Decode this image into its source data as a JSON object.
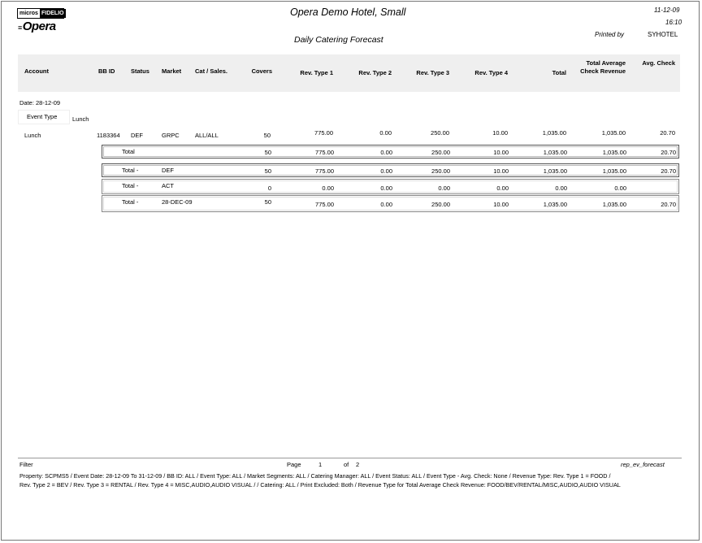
{
  "header": {
    "logo_left": "micros",
    "logo_right": "FIDELIO",
    "brand": "Opera",
    "hotel_name": "Opera Demo Hotel, Small",
    "report_title": "Daily Catering Forecast",
    "date": "11-12-09",
    "time": "16:10",
    "printed_by_label": "Printed by",
    "printed_by_value": "SYHOTEL"
  },
  "columns": {
    "account": "Account",
    "bb_id": "BB ID",
    "status": "Status",
    "market": "Market",
    "cat_sales": "Cat / Sales.",
    "covers": "Covers",
    "rev1": "Rev. Type 1",
    "rev2": "Rev. Type 2",
    "rev3": "Rev. Type 3",
    "rev4": "Rev. Type 4",
    "total": "Total",
    "tavg_line1": "Total Average",
    "tavg_line2": "Check Revenue",
    "avg_check": "Avg. Check"
  },
  "group": {
    "date_label": "Date: 28-12-09",
    "event_type_label": "Event Type",
    "event_type_value": "Lunch"
  },
  "detail_row": {
    "account": "Lunch",
    "bb_id": "1183364",
    "status": "DEF",
    "market": "GRPC",
    "cat_sales": "ALL/ALL",
    "covers": "50",
    "rev1": "775.00",
    "rev2": "0.00",
    "rev3": "250.00",
    "rev4": "10.00",
    "total": "1,035.00",
    "tavg": "1,035.00",
    "avg_check": "20.70"
  },
  "total_rows": [
    {
      "label": "Total",
      "qualifier": "",
      "covers": "50",
      "rev1": "775.00",
      "rev2": "0.00",
      "rev3": "250.00",
      "rev4": "10.00",
      "total": "1,035.00",
      "tavg": "1,035.00",
      "avg_check": "20.70"
    },
    {
      "label": "Total -",
      "qualifier": "DEF",
      "covers": "50",
      "rev1": "775.00",
      "rev2": "0.00",
      "rev3": "250.00",
      "rev4": "10.00",
      "total": "1,035.00",
      "tavg": "1,035.00",
      "avg_check": "20.70"
    },
    {
      "label": "Total -",
      "qualifier": "ACT",
      "covers": "0",
      "rev1": "0.00",
      "rev2": "0.00",
      "rev3": "0.00",
      "rev4": "0.00",
      "total": "0.00",
      "tavg": "0.00",
      "avg_check": ""
    },
    {
      "label": "Total -",
      "qualifier": "28-DEC-09",
      "covers": "50",
      "rev1": "775.00",
      "rev2": "0.00",
      "rev3": "250.00",
      "rev4": "10.00",
      "total": "1,035.00",
      "tavg": "1,035.00",
      "avg_check": "20.70"
    }
  ],
  "footer": {
    "filter_label": "Filter",
    "page_label": "Page",
    "page_number": "1",
    "of_label": "of",
    "page_total": "2",
    "report_code": "rep_ev_forecast",
    "properties_line1": "Property: SCPMS5 / Event Date:  28-12-09 To 31-12-09  /  BB ID: ALL  /  Event Type: ALL  /  Market Segments: ALL  /  Catering Manager: ALL  /  Event Status: ALL  /  Event Type - Avg. Check: None  /  Revenue Type: Rev. Type 1 = FOOD /",
    "properties_line2": "Rev. Type 2 = BEV / Rev. Type 3 = RENTAL / Rev. Type 4 = MISC,AUDIO,AUDIO VISUAL /   /  Catering:  ALL  /  Print Excluded:  Both  /  Revenue Type for Total Average Check Revenue: FOOD/BEV/RENTAL/MISC,AUDIO,AUDIO VISUAL"
  }
}
